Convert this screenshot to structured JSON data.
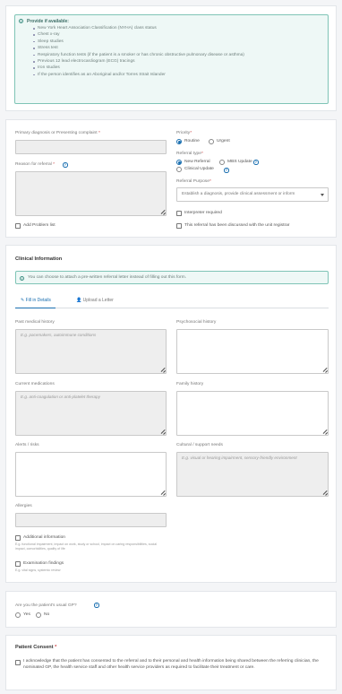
{
  "info_box": {
    "heading": "Provide if available:",
    "items": [
      "New York Heart Association Classification (NYHA) class status",
      "Chest x-ray",
      "Sleep studies",
      "Stress test",
      "Respiratory function tests (if the patient is a smoker or has chronic obstructive pulmonary disease or asthma)",
      "Previous 12 lead electrocardiogram (ECG) tracings",
      "Iron studies",
      "If the person identifies as an Aboriginal and/or Torres Strait Islander"
    ]
  },
  "referral": {
    "primary_diagnosis_label": "Primary diagnosis or Presenting complaint",
    "reason_label": "Reason for referral",
    "add_problem_label": "Add Problem list",
    "priority_label": "Priority",
    "priority_options": [
      "Routine",
      "Urgent"
    ],
    "priority_selected": "Routine",
    "referral_type_label": "Referral type",
    "referral_type_options": [
      "New Referral",
      "MBS Update",
      "Clinical Update"
    ],
    "referral_type_selected": "New Referral",
    "referral_purpose_label": "Referral Purpose",
    "referral_purpose_value": "Establish a diagnosis, provide clinical assessment or inform",
    "interpreter_label": "Interpreter required",
    "discussed_label": "This referral has been discussed with the unit registrar",
    "required_mark": "*"
  },
  "clinical": {
    "title": "Clinical Information",
    "notice": "You can choose to attach a pre-written referral letter instead of filling out this form.",
    "tabs": [
      "Fill in Details",
      "Upload a Letter"
    ],
    "past_history_label": "Past medical history",
    "past_history_placeholder": "E.g. pacemakers, autoimmune conditions",
    "psychosocial_label": "Psychosocial history",
    "current_meds_label": "Current medications",
    "current_meds_placeholder": "E.g. anti-coagulation or anti-platelet therapy",
    "family_history_label": "Family history",
    "alerts_label": "Alerts / risks",
    "cultural_label": "Cultural / support needs",
    "cultural_placeholder": "E.g. visual or hearing impairment, sensory-friendly environment",
    "allergies_label": "Allergies",
    "additional_info_label": "Additional information",
    "additional_info_sub": "E.g. functional impairment, impact on work, study or school, impact on caring responsibilities, social impact, comorbidities, quality of life",
    "exam_findings_label": "Examination findings",
    "exam_findings_sub": "E.g. vital signs, systemic review"
  },
  "gp": {
    "question": "Are you the patient's usual GP?",
    "options": [
      "Yes",
      "No"
    ]
  },
  "consent": {
    "title": "Patient Consent",
    "required_mark": "*",
    "text": "I acknowledge that the patient has consented to the referral and to their personal and health information being shared between the referring clinician, the nominated GP, the health service staff and other health service providers as required to facilitate their treatment or care."
  },
  "colors": {
    "accent": "#1a6fb0",
    "info_bg": "#eef8f6",
    "info_border": "#7fc4b6"
  }
}
